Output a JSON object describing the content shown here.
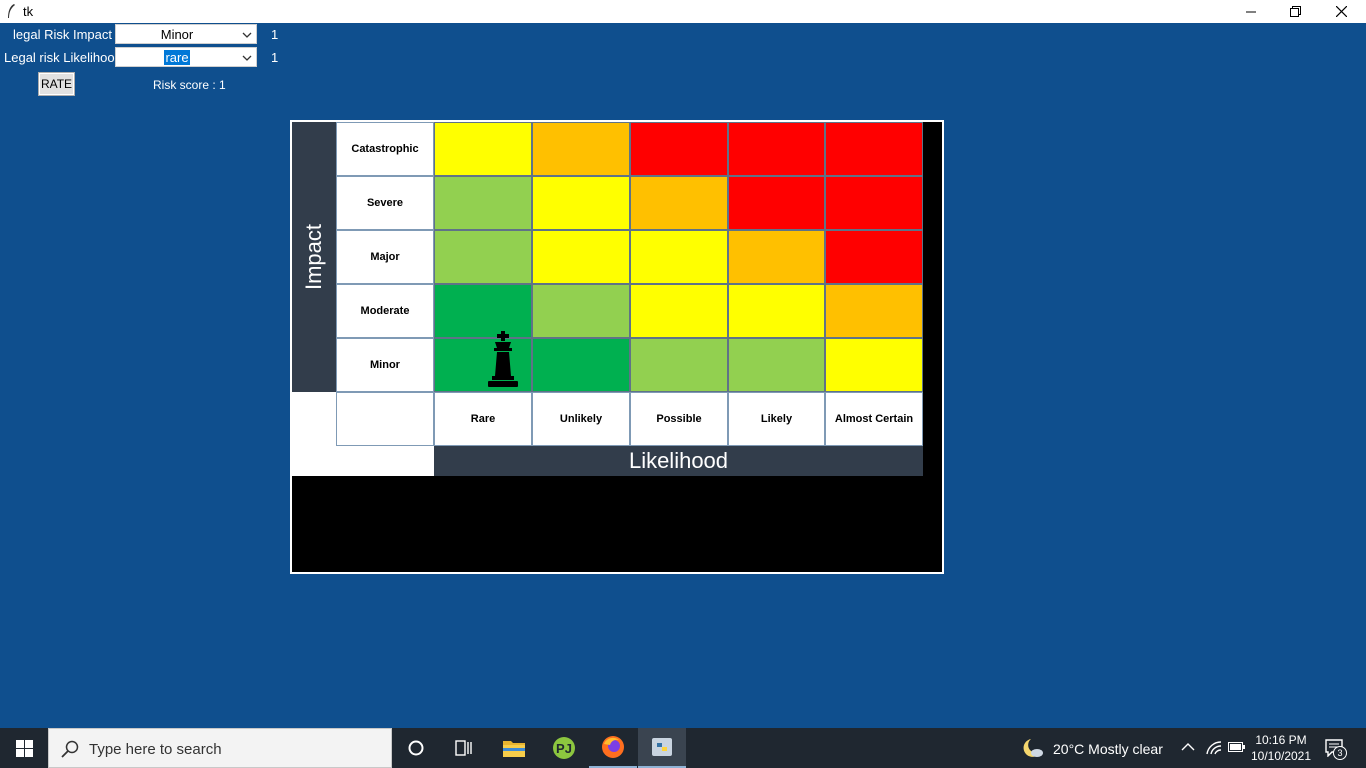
{
  "window": {
    "title": "tk"
  },
  "form": {
    "impact_label": "legal Risk Impact",
    "impact_value": "Minor",
    "impact_count": "1",
    "likelihood_label": "Legal risk Likelihood",
    "likelihood_value": "rare",
    "likelihood_count": "1",
    "rate_label": "RATE",
    "risk_score": "Risk score : 1"
  },
  "matrix": {
    "impact_axis": "Impact",
    "likelihood_axis": "Likelihood",
    "rows": [
      "Catastrophic",
      "Severe",
      "Major",
      "Moderate",
      "Minor"
    ],
    "columns": [
      "Rare",
      "Unlikely",
      "Possible",
      "Likely",
      "Almost Certain"
    ],
    "colors": {
      "dark_green": "#00b050",
      "light_green": "#92d050",
      "yellow": "#ffff00",
      "orange": "#ffc000",
      "red": "#ff0000"
    },
    "cells": [
      [
        "#ffff00",
        "#ffc000",
        "#ff0000",
        "#ff0000",
        "#ff0000"
      ],
      [
        "#92d050",
        "#ffff00",
        "#ffc000",
        "#ff0000",
        "#ff0000"
      ],
      [
        "#92d050",
        "#ffff00",
        "#ffff00",
        "#ffc000",
        "#ff0000"
      ],
      [
        "#00b050",
        "#92d050",
        "#ffff00",
        "#ffff00",
        "#ffc000"
      ],
      [
        "#00b050",
        "#00b050",
        "#92d050",
        "#92d050",
        "#ffff00"
      ]
    ],
    "marker": {
      "icon": "chess-king-icon",
      "row": "Minor",
      "column": "Rare"
    }
  },
  "taskbar": {
    "search_placeholder": "Type here to search",
    "weather": "20°C  Mostly clear",
    "time": "10:16 PM",
    "date": "10/10/2021",
    "notification_count": "3"
  }
}
